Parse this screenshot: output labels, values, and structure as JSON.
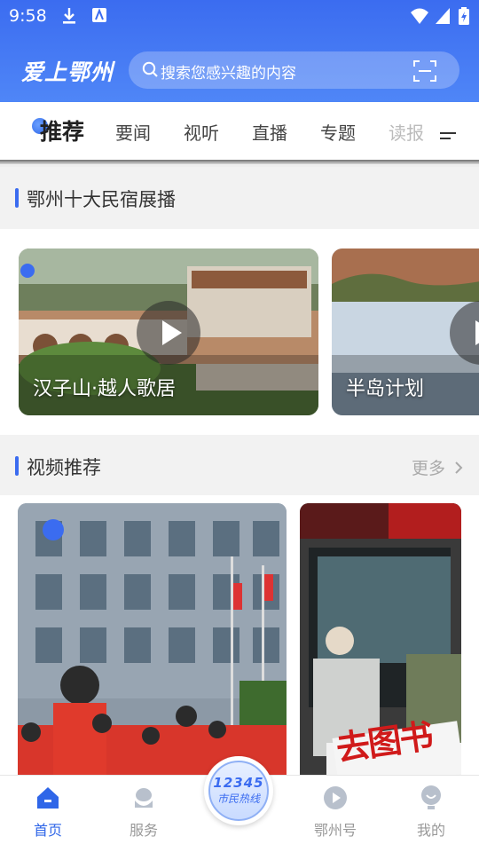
{
  "status_bar": {
    "time": "9:58"
  },
  "header": {
    "logo_text": "爱上鄂州",
    "search_placeholder": "搜索您感兴趣的内容"
  },
  "tabs": [
    {
      "label": "推荐",
      "active": true
    },
    {
      "label": "要闻"
    },
    {
      "label": "视听"
    },
    {
      "label": "直播"
    },
    {
      "label": "专题"
    },
    {
      "label": "读报"
    }
  ],
  "sections": {
    "homestay": {
      "title": "鄂州十大民宿展播"
    },
    "video": {
      "title": "视频推荐",
      "more_label": "更多"
    }
  },
  "carousel": [
    {
      "title": "汉子山·越人歌居"
    },
    {
      "title": "半岛计划"
    }
  ],
  "videos": [
    {
      "id": "video-1"
    },
    {
      "id": "video-2"
    }
  ],
  "bottom_nav": [
    {
      "label": "首页",
      "icon": "home-icon",
      "active": true
    },
    {
      "label": "服务",
      "icon": "service-icon"
    },
    {
      "label": "鄂州号",
      "icon": "ezhou-hao-icon"
    },
    {
      "label": "我的",
      "icon": "profile-icon"
    }
  ],
  "hotline": {
    "number": "12345",
    "label": "市民热线"
  },
  "colors": {
    "brand_blue": "#3b6cf0",
    "accent_blue": "#2f66e8"
  }
}
